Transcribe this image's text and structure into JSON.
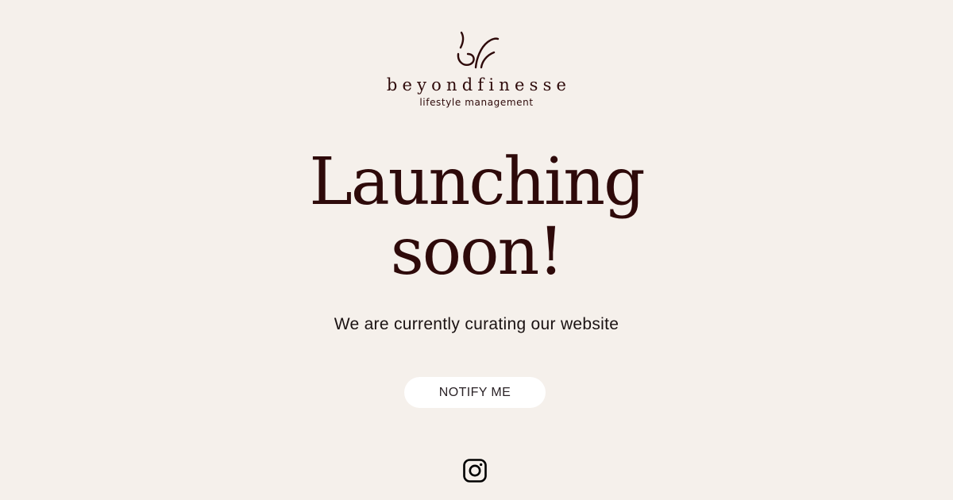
{
  "brand": {
    "name": "beyondfinesse",
    "tagline": "lifestyle management",
    "logo_icon": "bf-monogram-logo"
  },
  "hero": {
    "headline_line1": "Launching",
    "headline_line2": "soon!",
    "subtitle": "We are currently curating our website"
  },
  "cta": {
    "notify_label": "NOTIFY ME"
  },
  "social": {
    "icon": "instagram-icon"
  },
  "colors": {
    "background": "#f5f0eb",
    "brand_dark": "#2e0a0a",
    "button_bg": "#ffffff"
  }
}
